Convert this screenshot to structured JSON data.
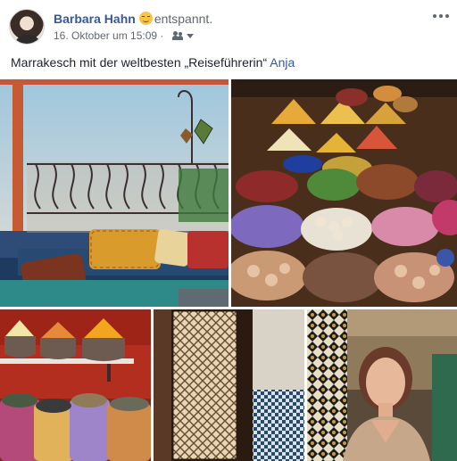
{
  "post": {
    "author": "Barbara Hahn",
    "feeling": "entspannt.",
    "feeling_icon": "relieved-face-icon",
    "timestamp": "16. Oktober um 15:09",
    "audience_icon": "friends-icon",
    "caption_text": "Marrakesch mit der weltbesten „Reiseführerin“",
    "mention": "Anja"
  },
  "photos": [
    {
      "subject": "rooftop-terrace-photo"
    },
    {
      "subject": "spice-market-bowls-photo"
    },
    {
      "subject": "spice-cones-on-shelf-photo"
    },
    {
      "subject": "carved-lattice-window-photo"
    },
    {
      "subject": "woman-portrait-photo"
    }
  ],
  "colors": {
    "link": "#365899",
    "meta": "#616770",
    "text": "#1d2129"
  }
}
